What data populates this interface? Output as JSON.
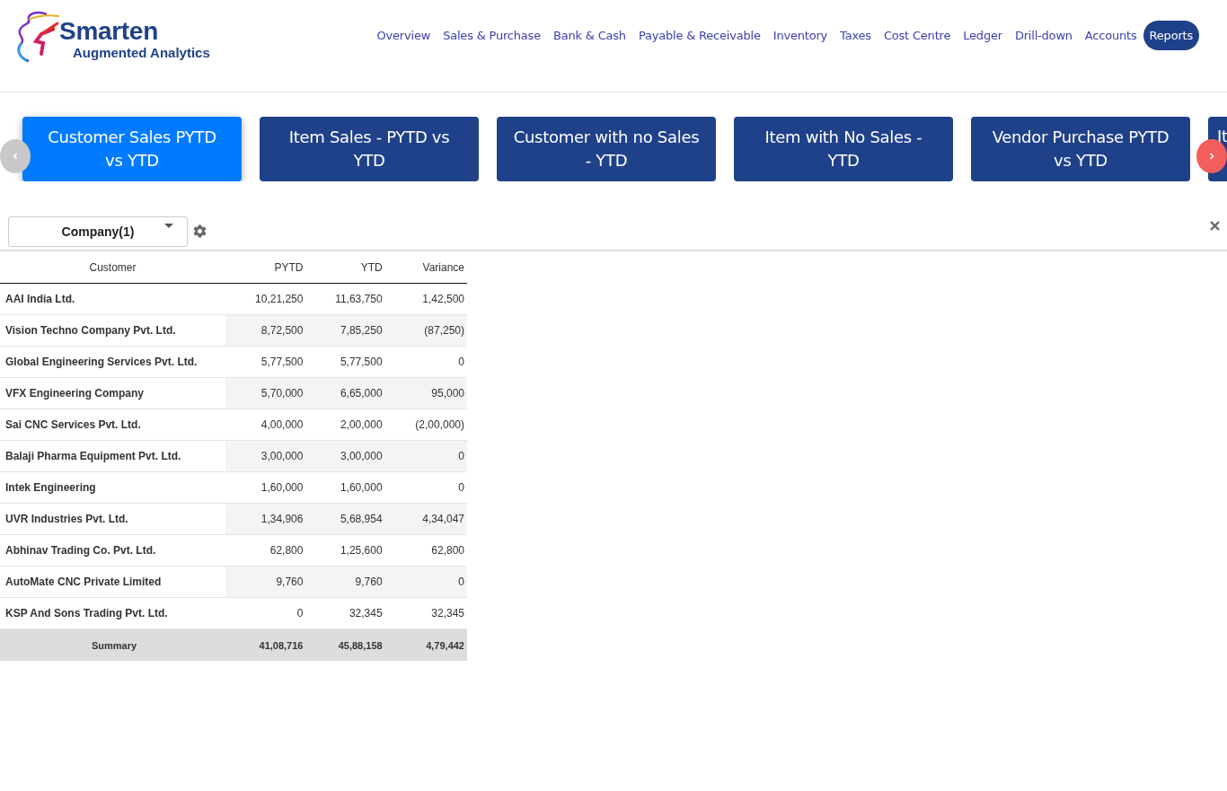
{
  "logo": {
    "name": "Smarten",
    "tagline": "Augmented Analytics"
  },
  "nav": [
    {
      "label": "Overview",
      "selected": false
    },
    {
      "label": "Sales & Purchase",
      "selected": false
    },
    {
      "label": "Bank & Cash",
      "selected": false
    },
    {
      "label": "Payable & Receivable",
      "selected": false
    },
    {
      "label": "Inventory",
      "selected": false
    },
    {
      "label": "Taxes",
      "selected": false
    },
    {
      "label": "Cost Centre",
      "selected": false
    },
    {
      "label": "Ledger",
      "selected": false
    },
    {
      "label": "Drill-down",
      "selected": false
    },
    {
      "label": "Accounts",
      "selected": false
    },
    {
      "label": "Reports",
      "selected": true
    }
  ],
  "report_cards": [
    {
      "label": "Customer Sales PYTD vs YTD",
      "selected": true
    },
    {
      "label": "Item Sales - PYTD vs YTD",
      "selected": false
    },
    {
      "label": "Customer with no Sales - YTD",
      "selected": false
    },
    {
      "label": "Item with No Sales - YTD",
      "selected": false
    },
    {
      "label": "Vendor Purchase PYTD vs YTD",
      "selected": false
    },
    {
      "label": "It",
      "selected": false
    }
  ],
  "filter": {
    "value": "Company(1)"
  },
  "table": {
    "columns": [
      "Customer",
      "PYTD",
      "YTD",
      "Variance"
    ],
    "rows": [
      [
        "AAI India Ltd.",
        "10,21,250",
        "11,63,750",
        "1,42,500"
      ],
      [
        "Vision Techno Company Pvt. Ltd.",
        "8,72,500",
        "7,85,250",
        "(87,250)"
      ],
      [
        "Global Engineering Services Pvt. Ltd.",
        "5,77,500",
        "5,77,500",
        "0"
      ],
      [
        "VFX Engineering Company",
        "5,70,000",
        "6,65,000",
        "95,000"
      ],
      [
        "Sai CNC Services Pvt. Ltd.",
        "4,00,000",
        "2,00,000",
        "(2,00,000)"
      ],
      [
        "Balaji Pharma Equipment Pvt. Ltd.",
        "3,00,000",
        "3,00,000",
        "0"
      ],
      [
        "Intek Engineering",
        "1,60,000",
        "1,60,000",
        "0"
      ],
      [
        "UVR Industries Pvt. Ltd.",
        "1,34,906",
        "5,68,954",
        "4,34,047"
      ],
      [
        "Abhinav Trading Co. Pvt. Ltd.",
        "62,800",
        "1,25,600",
        "62,800"
      ],
      [
        "AutoMate CNC Private Limited",
        "9,760",
        "9,760",
        "0"
      ],
      [
        "KSP And Sons Trading Pvt. Ltd.",
        "0",
        "32,345",
        "32,345"
      ]
    ],
    "summary": [
      "Summary",
      "41,08,716",
      "45,88,158",
      "4,79,442"
    ]
  }
}
